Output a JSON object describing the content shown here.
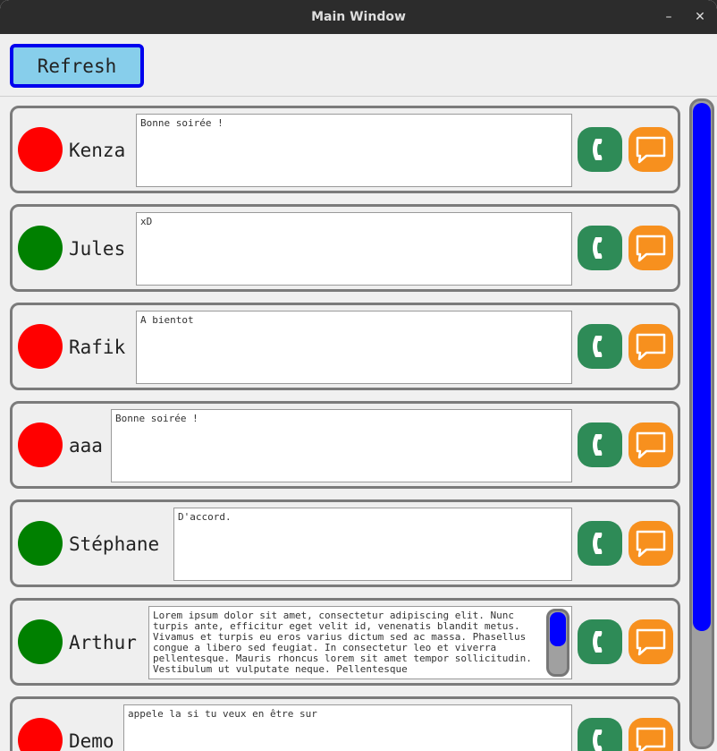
{
  "window": {
    "title": "Main Window",
    "minimize_glyph": "–",
    "close_glyph": "✕"
  },
  "toolbar": {
    "refresh_label": "Refresh"
  },
  "colors": {
    "online": "#008000",
    "offline": "#ff0000",
    "call": "#2e8b57",
    "chat": "#f7901e",
    "accent": "#0000ff",
    "refresh_bg": "#87ceeb"
  },
  "contacts": [
    {
      "name": "Kenza",
      "status": "offline",
      "message": "Bonne soirée !"
    },
    {
      "name": "Jules",
      "status": "online",
      "message": "xD"
    },
    {
      "name": "Rafik",
      "status": "offline",
      "message": "A bientot"
    },
    {
      "name": "aaa",
      "status": "offline",
      "message": "Bonne soirée !"
    },
    {
      "name": "Stéphane",
      "status": "online",
      "message": "D'accord."
    },
    {
      "name": "Arthur",
      "status": "online",
      "message": "Lorem ipsum dolor sit amet, consectetur adipiscing elit. Nunc turpis ante, efficitur eget velit id, venenatis blandit metus. Vivamus et turpis eu eros varius dictum sed ac massa. Phasellus congue a libero sed feugiat. In consectetur leo et viverra pellentesque. Mauris rhoncus lorem sit amet tempor sollicitudin. Vestibulum ut vulputate neque. Pellentesque"
    },
    {
      "name": "Demo",
      "status": "offline",
      "message": "appele la si tu veux en être sur"
    }
  ],
  "icons": {
    "call": "phone-icon",
    "chat": "chat-bubble-icon"
  }
}
